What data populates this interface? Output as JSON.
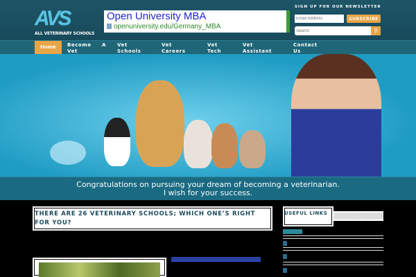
{
  "logo": {
    "mark": "AVS",
    "subtitle": "ALL VETERINARY SCHOOLS"
  },
  "ad": {
    "title": "Open University MBA",
    "url": "openuniversity.edu/Germany_MBA"
  },
  "newsletter": {
    "title": "SIGN UP FOR OUR NEWSLETTER",
    "email_placeholder": "Email Address",
    "subscribe_label": "SUBSCRIBE",
    "search_placeholder": "Search"
  },
  "nav": {
    "items": [
      {
        "label": "Home"
      },
      {
        "label": "Become Vet"
      },
      {
        "label": "A"
      },
      {
        "label": "Vet Schools"
      },
      {
        "label": "Vet Careers"
      },
      {
        "label": "Vet Tech"
      },
      {
        "label": "Vet Assistant"
      },
      {
        "label": "Contact Us"
      }
    ]
  },
  "hero": {
    "caption_line1": "Congratulations on pursuing your dream of becoming a veterinarian.",
    "caption_line2": "I wish for your success."
  },
  "post": {
    "title": "THERE ARE 26 VETERINARY SCHOOLS; WHICH ONE’S RIGHT FOR YOU?"
  },
  "sidebar": {
    "title": "USEFUL LINKS"
  },
  "colors": {
    "header": "#1b4f63",
    "nav": "#1f6678",
    "accent": "#e8a445",
    "hero": "#2aa6c8"
  }
}
